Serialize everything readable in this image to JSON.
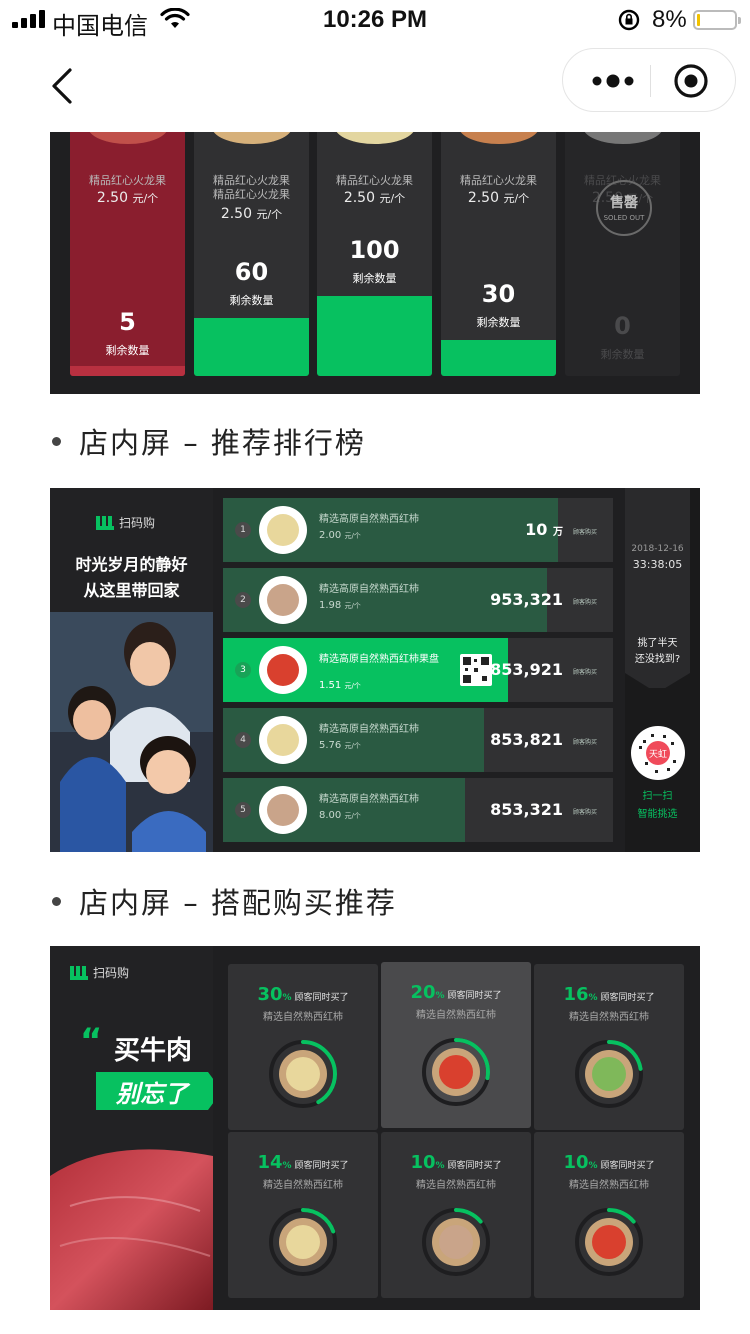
{
  "status_bar": {
    "carrier": "中国电信",
    "time": "10:26 PM",
    "battery_percent": "8%",
    "battery_level": 0.08
  },
  "nav": {
    "back_icon": "chevron-left-icon",
    "more_icon": "more-dots-icon",
    "close_icon": "target-circle-icon"
  },
  "panel1": {
    "columns": [
      {
        "name": "精品红心火龙果",
        "price": "2.50",
        "unit": "元/个",
        "qty": "5",
        "qty_label": "剩余数量",
        "style": "red"
      },
      {
        "name": "精品红心火龙果\n精品红心火龙果",
        "price": "2.50",
        "unit": "元/个",
        "qty": "60",
        "qty_label": "剩余数量",
        "style": "normal"
      },
      {
        "name": "精品红心火龙果",
        "price": "2.50",
        "unit": "元/个",
        "qty": "100",
        "qty_label": "剩余数量",
        "style": "normal"
      },
      {
        "name": "精品红心火龙果",
        "price": "2.50",
        "unit": "元/个",
        "qty": "30",
        "qty_label": "剩余数量",
        "style": "normal"
      },
      {
        "name": "精品红心火龙果",
        "price": "2.50",
        "unit": "元/个",
        "qty": "0",
        "qty_label": "剩余数量",
        "style": "dim"
      }
    ],
    "sold_out_cn": "售罄",
    "sold_out_en": "SOLED OUT"
  },
  "section2_title": "店内屏 – 推荐排行榜",
  "panel2": {
    "logo": "扫码购",
    "slogan_line1": "时光岁月的静好",
    "slogan_line2": "从这里带回家",
    "rows": [
      {
        "rank": "1",
        "name": "精选高原自然熟西红柿",
        "price": "2.00",
        "unit": "元/个",
        "count": "10",
        "count_unit": "万",
        "label": "顾客购买",
        "fill": 0.86,
        "highlight": false
      },
      {
        "rank": "2",
        "name": "精选高原自然熟西红柿",
        "price": "1.98",
        "unit": "元/个",
        "count": "953,321",
        "count_unit": "",
        "label": "顾客购买",
        "fill": 0.83,
        "highlight": false
      },
      {
        "rank": "3",
        "name": "精选高原自然熟西红柿果盘",
        "price": "1.51",
        "unit": "元/个",
        "count": "853,921",
        "count_unit": "",
        "label": "顾客购买",
        "fill": 0.73,
        "highlight": true
      },
      {
        "rank": "4",
        "name": "精选高原自然熟西红柿",
        "price": "5.76",
        "unit": "元/个",
        "count": "853,821",
        "count_unit": "",
        "label": "顾客购买",
        "fill": 0.67,
        "highlight": false
      },
      {
        "rank": "5",
        "name": "精选高原自然熟西红柿",
        "price": "8.00",
        "unit": "元/个",
        "count": "853,321",
        "count_unit": "",
        "label": "顾客购买",
        "fill": 0.62,
        "highlight": false
      }
    ],
    "date": "2018-12-16",
    "clock": "33:38:05",
    "ask_line1": "挑了半天",
    "ask_line2": "还没找到?",
    "mini_code_label": "天虹",
    "scan_line1": "扫一扫",
    "scan_line2": "智能挑选"
  },
  "section3_title": "店内屏 – 搭配购买推荐",
  "panel3": {
    "logo": "扫码购",
    "quote": "“",
    "headline": "买牛肉",
    "tag": "别忘了",
    "cells": [
      {
        "pct": "30",
        "also": "顾客同时买了",
        "name": "精选自然熟西红柿",
        "ratio": 0.3,
        "highlight": false
      },
      {
        "pct": "20",
        "also": "顾客同时买了",
        "name": "精选自然熟西红柿",
        "ratio": 0.2,
        "highlight": true
      },
      {
        "pct": "16",
        "also": "顾客同时买了",
        "name": "精选自然熟西红柿",
        "ratio": 0.16,
        "highlight": false
      },
      {
        "pct": "14",
        "also": "顾客同时买了",
        "name": "精选自然熟西红柿",
        "ratio": 0.14,
        "highlight": false
      },
      {
        "pct": "10",
        "also": "顾客同时买了",
        "name": "精选自然熟西红柿",
        "ratio": 0.1,
        "highlight": false
      },
      {
        "pct": "10",
        "also": "顾客同时买了",
        "name": "精选自然熟西红柿",
        "ratio": 0.1,
        "highlight": false
      }
    ]
  },
  "colors": {
    "accent_green": "#07c160",
    "panel_bg": "#1f1f21",
    "alert_red": "#8a1e2e"
  }
}
